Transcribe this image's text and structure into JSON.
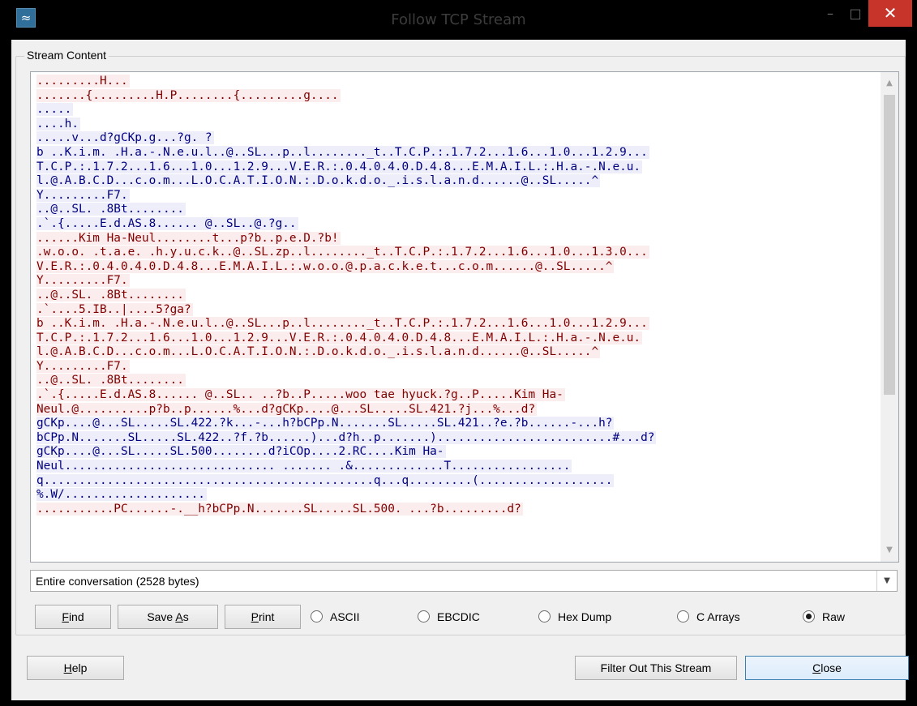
{
  "window": {
    "title": "Follow TCP Stream",
    "app_icon_glyph": "≈",
    "minimize_glyph": "–",
    "maximize_glyph": "□",
    "close_glyph": "✕"
  },
  "stream": {
    "group_label": "Stream Content",
    "lines": [
      {
        "dir": "c",
        "text": ".........H..."
      },
      {
        "dir": "c",
        "text": ".......{.........H.P........{.........g...."
      },
      {
        "dir": "s",
        "text": "....."
      },
      {
        "dir": "s",
        "text": "....h."
      },
      {
        "dir": "s",
        "text": ".....v...d?gCKp.g...?g. ?"
      },
      {
        "dir": "s",
        "text": "b ..K.i.m. .H.a.-.N.e.u.l..@..SL...p..l........_t..T.C.P.:.1.7.2...1.6...1.0...1.2.9..."
      },
      {
        "dir": "s",
        "text": "T.C.P.:.1.7.2...1.6...1.0...1.2.9...V.E.R.:.0.4.0.4.0.D.4.8...E.M.A.I.L.:.H.a.-.N.e.u."
      },
      {
        "dir": "s",
        "text": "l.@.A.B.C.D...c.o.m...L.O.C.A.T.I.O.N.:.D.o.k.d.o._.i.s.l.a.n.d......@..SL.....^"
      },
      {
        "dir": "s",
        "text": "Y.........F7."
      },
      {
        "dir": "s",
        "text": "..@..SL. .8Bt........"
      },
      {
        "dir": "s",
        "text": ".`.{.....E.d.AS.8...... @..SL..@.?g.."
      },
      {
        "dir": "c",
        "text": "......Kim Ha-Neul........t...p?b..p.e.D.?b!"
      },
      {
        "dir": "c",
        "text": ".w.o.o. .t.a.e. .h.y.u.c.k..@..SL.zp..l........_t..T.C.P.:.1.7.2...1.6...1.0...1.3.0..."
      },
      {
        "dir": "c",
        "text": "V.E.R.:.0.4.0.4.0.D.4.8...E.M.A.I.L.:.w.o.o.@.p.a.c.k.e.t...c.o.m......@..SL.....^"
      },
      {
        "dir": "c",
        "text": "Y.........F7."
      },
      {
        "dir": "c",
        "text": "..@..SL. .8Bt........"
      },
      {
        "dir": "c",
        "text": ".`....5.IB..|....5?ga?"
      },
      {
        "dir": "c",
        "text": "b ..K.i.m. .H.a.-.N.e.u.l..@..SL...p..l........_t..T.C.P.:.1.7.2...1.6...1.0...1.2.9..."
      },
      {
        "dir": "c",
        "text": "T.C.P.:.1.7.2...1.6...1.0...1.2.9...V.E.R.:.0.4.0.4.0.D.4.8...E.M.A.I.L.:.H.a.-.N.e.u."
      },
      {
        "dir": "c",
        "text": "l.@.A.B.C.D...c.o.m...L.O.C.A.T.I.O.N.:.D.o.k.d.o._.i.s.l.a.n.d......@..SL.....^"
      },
      {
        "dir": "c",
        "text": "Y.........F7."
      },
      {
        "dir": "c",
        "text": "..@..SL. .8Bt........"
      },
      {
        "dir": "c",
        "text": ".`.{.....E.d.AS.8...... @..SL.. ..?b..P.....woo tae hyuck.?g..P.....Kim Ha-"
      },
      {
        "dir": "c",
        "text": "Neul.@..........p?b..p......%...d?gCKp....@...SL.....SL.421.?j...%...d?"
      },
      {
        "dir": "s",
        "text": "gCKp....@...SL.....SL.422.?k...-...h?bCPp.N.......SL.....SL.421..?e.?b......-...h?"
      },
      {
        "dir": "s",
        "text": "bCPp.N.......SL.....SL.422..?f.?b......)...d?h..p.......).........................#...d?"
      },
      {
        "dir": "s",
        "text": "gCKp....@...SL.....SL.500........d?iCOp....2.RC....Kim Ha-"
      },
      {
        "dir": "s",
        "text": "Neul.............................. ....... .&.............T................."
      },
      {
        "dir": "s",
        "text": "q...............................................q...q.........(..................."
      },
      {
        "dir": "s",
        "text": "%.W/...................."
      },
      {
        "dir": "c",
        "text": "...........PC......-.__h?bCPp.N.......SL.....SL.500. ...?b.........d?"
      }
    ]
  },
  "conversation_select": {
    "value": "Entire conversation (2528 bytes)"
  },
  "buttons": {
    "find": {
      "pre": "",
      "key": "F",
      "post": "ind"
    },
    "save_as": {
      "pre": "Save ",
      "key": "A",
      "post": "s"
    },
    "print": {
      "pre": "",
      "key": "P",
      "post": "rint"
    },
    "help": {
      "pre": "",
      "key": "H",
      "post": "elp"
    },
    "filter_out": "Filter Out This Stream",
    "close": {
      "pre": "",
      "key": "C",
      "post": "lose"
    }
  },
  "formats": [
    {
      "label": "ASCII",
      "selected": false
    },
    {
      "label": "EBCDIC",
      "selected": false
    },
    {
      "label": "Hex Dump",
      "selected": false
    },
    {
      "label": "C Arrays",
      "selected": false
    },
    {
      "label": "Raw",
      "selected": true
    }
  ],
  "colors": {
    "client_fg": "#800000",
    "client_bg": "#fbeded",
    "server_fg": "#00007f",
    "server_bg": "#eeeefb"
  }
}
